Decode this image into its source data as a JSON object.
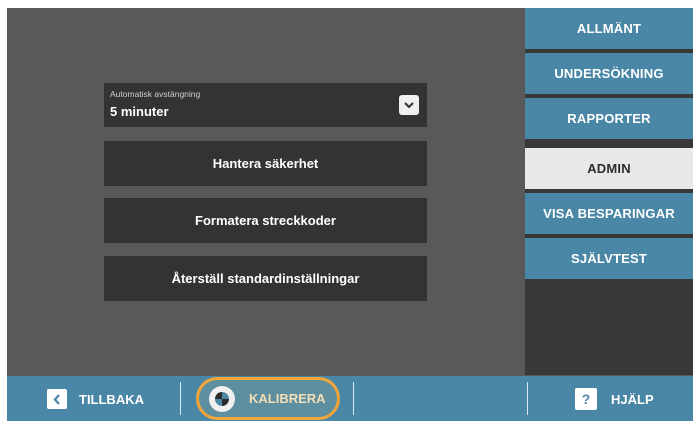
{
  "sidebar": {
    "items": [
      {
        "label": "ALLMÄNT"
      },
      {
        "label": "UNDERSÖKNING"
      },
      {
        "label": "RAPPORTER"
      },
      {
        "label": "ADMIN"
      },
      {
        "label": "VISA BESPARINGAR"
      },
      {
        "label": "SJÄLVTEST"
      }
    ],
    "active": "ADMIN"
  },
  "main": {
    "auto_off": {
      "label": "Automatisk avstängning",
      "value": "5 minuter"
    },
    "buttons": [
      {
        "label": "Hantera säkerhet"
      },
      {
        "label": "Formatera streckkoder"
      },
      {
        "label": "Återställ standardinställningar"
      }
    ]
  },
  "bottom": {
    "back_label": "TILLBAKA",
    "calibrate_label": "KALIBRERA",
    "help_label": "HJÄLP",
    "help_icon": "?"
  },
  "colors": {
    "accent": "#4a86a6",
    "highlight": "#f2a63a",
    "panel": "#333333",
    "background": "#595959"
  }
}
